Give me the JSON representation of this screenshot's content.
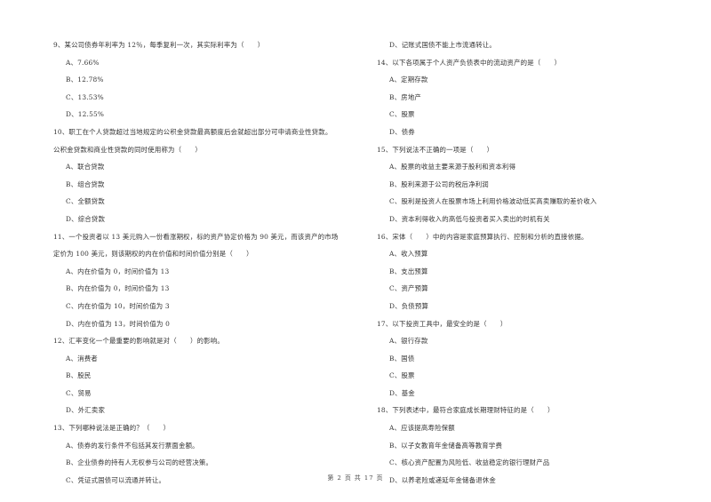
{
  "page": {
    "left_column": [
      {
        "number": "9、",
        "stem": [
          "9、某公司债券年利率为 12％，每季复利一次，其实际利率为（　　）"
        ],
        "options": [
          "A、7.66%",
          "B、12.78%",
          "C、13.53%",
          "D、12.55%"
        ]
      },
      {
        "number": "10、",
        "stem": [
          "10、职工在个人贷款超过当地规定的公积金贷款最高额度后会就超出部分可申请商业性贷款。",
          "公积金贷款和商业性贷款的同时使用称为（　　）"
        ],
        "options": [
          "A、联合贷款",
          "B、组合贷款",
          "C、全额贷款",
          "D、综合贷款"
        ]
      },
      {
        "number": "11、",
        "stem": [
          "11、一个投资者以 13 美元购入一份看涨期权，标的资产协定价格为 90 美元，而该资产的市场",
          "定价为 100 美元，则该期权的内在价值和时间价值分别是（　　）"
        ],
        "options": [
          "A、内在价值为 0，时间价值为 13",
          "B、内在价值为 0，时间价值为 13",
          "C、内在价值为 10，时间价值为 3",
          "D、内在价值为 13，时间价值为 0"
        ]
      },
      {
        "number": "12、",
        "stem": [
          "12、汇率变化一个最重要的影响就是对（　　）的影响。"
        ],
        "options": [
          "A、消费者",
          "B、股民",
          "C、贸易",
          "D、外汇卖家"
        ]
      },
      {
        "number": "13、",
        "stem": [
          "13、下列哪种说法是正确的？（　　）"
        ],
        "options": [
          "A、债券的发行条件不包括其发行票面金额。",
          "B、企业债券的持有人无权参与公司的经营决策。",
          "C、凭证式国债可以流通并转让。"
        ]
      }
    ],
    "right_column": [
      {
        "number": "",
        "stem": [],
        "options": [
          "D、记账式国债不能上市流通转让。"
        ]
      },
      {
        "number": "14、",
        "stem": [
          "14、以下各项属于个人资产负债表中的流动资产的是（　　）"
        ],
        "options": [
          "A、定期存款",
          "B、房地产",
          "C、股票",
          "D、债券"
        ]
      },
      {
        "number": "15、",
        "stem": [
          "15、下列说法不正确的一项是（　　）"
        ],
        "options": [
          "A、股票的收益主要来源于股利和资本利得",
          "B、股利来源于公司的税后净利润",
          "C、股利是投资人在股票市场上利用价格波动低买高卖赚取的差价收入",
          "D、资本利得收入的高低与投资者买入卖出的时机有关"
        ]
      },
      {
        "number": "16、",
        "stem": [
          "16、宋体（　　）中的内容是家庭预算执行、控制和分析的直接依据。"
        ],
        "options": [
          "A、收入预算",
          "B、支出预算",
          "C、资产预算",
          "D、负债预算"
        ]
      },
      {
        "number": "17、",
        "stem": [
          "17、以下投资工具中，最安全的是（　　）"
        ],
        "options": [
          "A、银行存款",
          "B、国债",
          "C、股票",
          "D、基金"
        ]
      },
      {
        "number": "18、",
        "stem": [
          "18、下列表述中，最符合家庭成长期理财特征的是（　　）"
        ],
        "options": [
          "A、应该提高寿险保额",
          "B、以子女教育年金储备高等教育学费",
          "C、核心资产配置为风险低、收益稳定的银行理财产品",
          "D、以养老险或递延年金储备退休金"
        ]
      }
    ],
    "footer": "第 2 页 共 17 页"
  }
}
